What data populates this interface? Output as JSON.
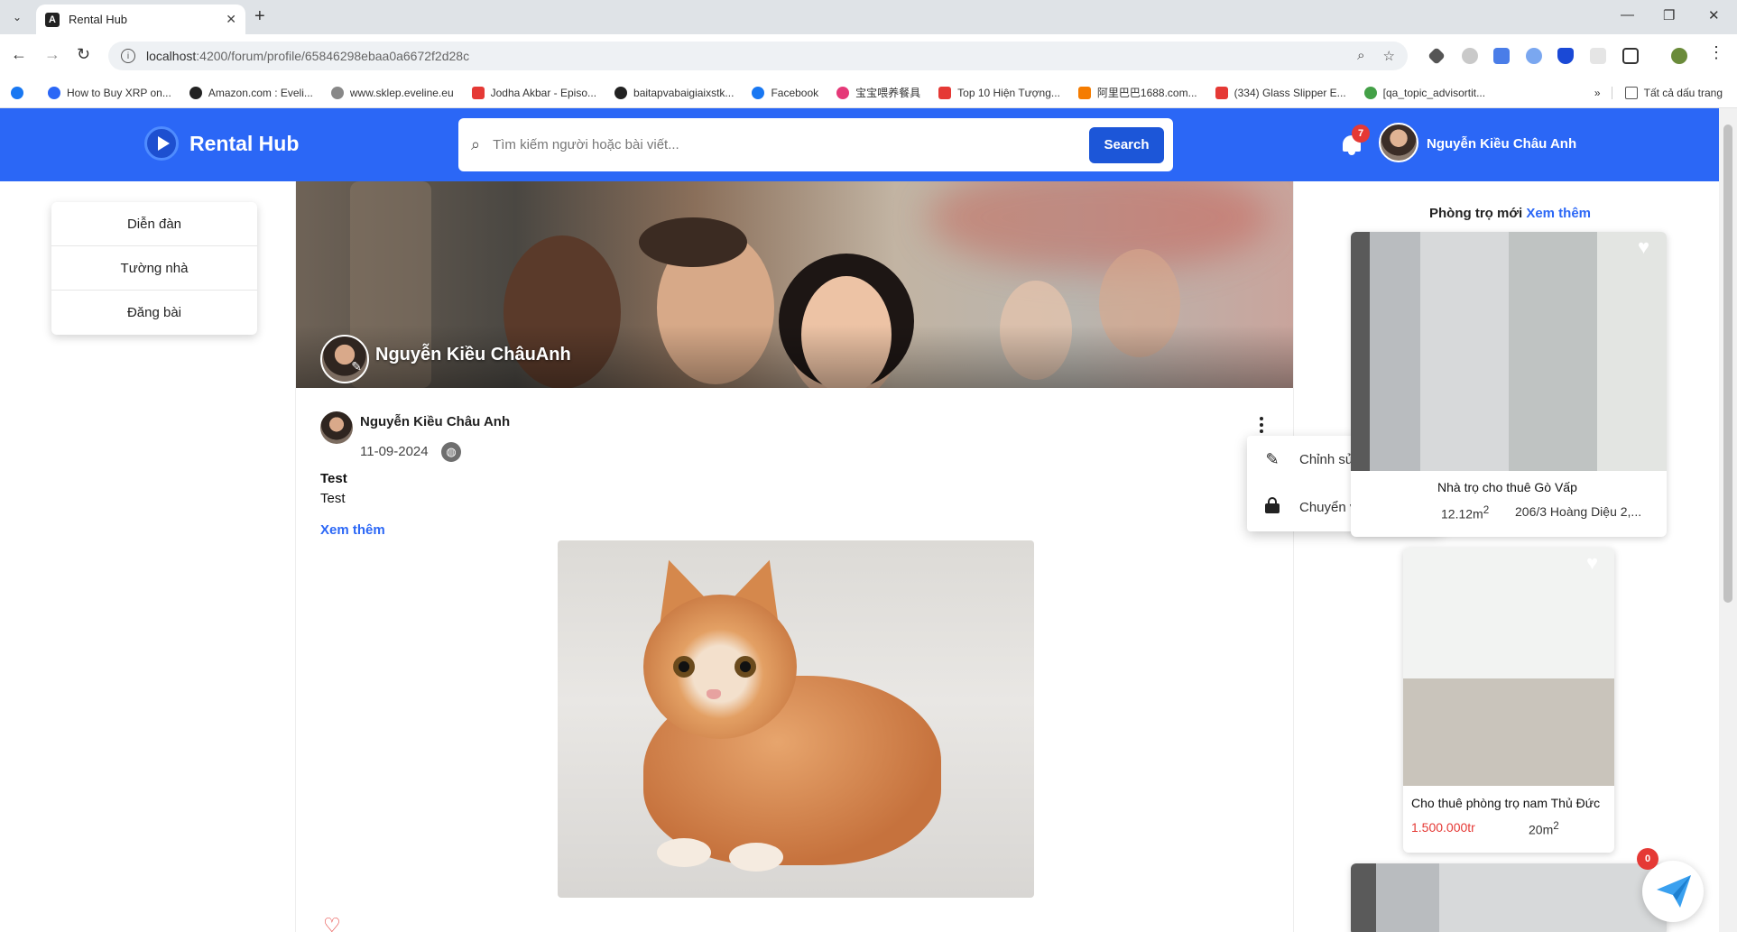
{
  "browser": {
    "tab_title": "Rental Hub",
    "url_host": "localhost",
    "url_path": ":4200/forum/profile/65846298ebaa0a6672f2d28c",
    "bookmarks": [
      {
        "label": "How to Buy XRP on...",
        "color": "#2b67f6"
      },
      {
        "label": "Amazon.com : Eveli...",
        "color": "#222222"
      },
      {
        "label": "www.sklep.eveline.eu",
        "color": "#888888"
      },
      {
        "label": "Jodha Akbar - Episo...",
        "color": "#e53935"
      },
      {
        "label": "baitapvabaigiaixstk...",
        "color": "#222222"
      },
      {
        "label": "Facebook",
        "color": "#1877f2"
      },
      {
        "label": "宝宝喂养餐具",
        "color": "#e53978"
      },
      {
        "label": "Top 10 Hiện Tượng...",
        "color": "#e53935"
      },
      {
        "label": "阿里巴巴1688.com...",
        "color": "#f57c00"
      },
      {
        "label": "(334) Glass Slipper E...",
        "color": "#e53935"
      },
      {
        "label": "[qa_topic_advisortit...",
        "color": "#43a047"
      }
    ],
    "all_bookmarks": "Tất cả dấu trang"
  },
  "header": {
    "brand": "Rental Hub",
    "search_placeholder": "Tìm kiếm người hoặc bài viết...",
    "search_button": "Search",
    "notification_count": "7",
    "user_name": "Nguyễn Kiều Châu Anh"
  },
  "leftnav": {
    "items": [
      "Diễn đàn",
      "Tường nhà",
      "Đăng bài"
    ]
  },
  "profile": {
    "cover_name": "Nguyễn Kiều ChâuAnh"
  },
  "post": {
    "author": "Nguyễn Kiều Châu Anh",
    "date": "11-09-2024",
    "title": "Test",
    "body": "Test",
    "see_more": "Xem thêm"
  },
  "post_menu": {
    "edit": "Chỉnh sửa",
    "make_private": "Chuyển về riêng tư"
  },
  "rooms": {
    "heading": "Phòng trọ mới",
    "see_more": "Xem thêm",
    "items": [
      {
        "title": "Nhà trọ cho thuê Gò Vấp",
        "area": "12.12m",
        "area_sup": "2",
        "address": "206/3 Hoàng Diệu 2,..."
      },
      {
        "title": "Cho thuê phòng trọ nam Thủ Đức",
        "price": "1.500.000tr",
        "area": "20m",
        "area_sup": "2"
      }
    ]
  },
  "chat": {
    "unread": "0"
  }
}
